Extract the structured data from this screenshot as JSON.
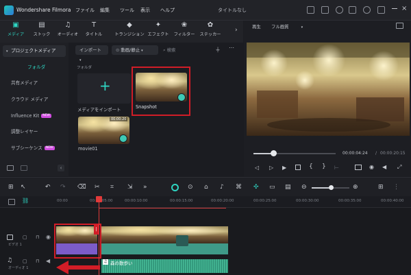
{
  "app": {
    "name": "Wondershare Filmora",
    "title": "タイトルなし"
  },
  "menu": [
    "ファイル",
    "編集",
    "ツール",
    "表示",
    "ヘルプ"
  ],
  "media_tabs": [
    {
      "label": "メディア",
      "icon": "media-icon"
    },
    {
      "label": "ストック",
      "icon": "stock-icon"
    },
    {
      "label": "オーディオ",
      "icon": "audio-icon"
    },
    {
      "label": "タイトル",
      "icon": "title-icon"
    },
    {
      "label": "トランジション",
      "icon": "transition-icon"
    },
    {
      "label": "エフェクト",
      "icon": "effect-icon"
    },
    {
      "label": "フィルター",
      "icon": "filter-icon"
    },
    {
      "label": "ステッカー",
      "icon": "sticker-icon"
    }
  ],
  "sidebar": {
    "items": [
      {
        "label": "プロジェクトメディア"
      },
      {
        "label": "フォルダ"
      },
      {
        "label": "共有メディア"
      },
      {
        "label": "クラウド メディア"
      },
      {
        "label": "Influence Kit",
        "badge": "NEW"
      },
      {
        "label": "調整レイヤー"
      },
      {
        "label": "サブシーケンス",
        "badge": "NEW"
      }
    ]
  },
  "media": {
    "import_label": "インポート",
    "filter_label": "動画/静止",
    "search_placeholder": "検索",
    "folder_label": "フォルダ",
    "import_tile_label": "メディアをインポート",
    "items": [
      {
        "label": "Snapshot"
      },
      {
        "label": "movie01",
        "duration": "00:00:20"
      }
    ]
  },
  "preview": {
    "mode_label": "再生",
    "quality_label": "フル画質",
    "current_time": "00:00:04:24",
    "separator": "/",
    "total_time": "00:00:20:15"
  },
  "timeline": {
    "ticks": [
      "00:00",
      "00:00:05:00",
      "00:00:10:00",
      "00:00:15:00",
      "00:00:20:00",
      "00:00:25:00",
      "00:00:30:00",
      "00:00:35:00",
      "00:00:40:00"
    ],
    "video_track_label": "ビデオ 1",
    "audio_track_label": "オーディオ 1",
    "audio_clip_label": "森の散歩い"
  },
  "colors": {
    "accent": "#2fd6c3",
    "highlight": "#d21d27",
    "video_clip": "#7c5cc9",
    "audio_clip": "#3aa887"
  }
}
